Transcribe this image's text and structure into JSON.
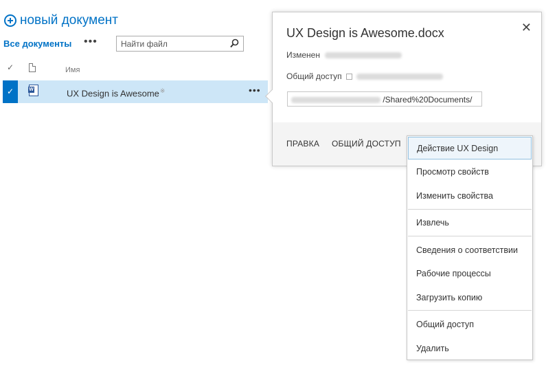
{
  "header": {
    "new_document_label": "новый документ",
    "view_tab_label": "Все документы",
    "view_more_label": "•••",
    "search_placeholder": "Найти файл"
  },
  "list": {
    "check_header": "✓",
    "name_header": "Имя",
    "rows": [
      {
        "name": "UX Design is Awesome",
        "new_badge": "※",
        "selected": true,
        "icon": "word-doc-icon"
      }
    ],
    "row_menu_label": "•••"
  },
  "callout": {
    "title": "UX Design is Awesome.docx",
    "modified_label": "Изменен",
    "sharing_label": "Общий доступ",
    "url_suffix": "/Shared%20Documents/",
    "actions": [
      "ПРАВКА",
      "ОБЩИЙ ДОСТУП"
    ],
    "close_label": "✕"
  },
  "context_menu": {
    "items": [
      "Действие UX Design",
      "Просмотр свойств",
      "Изменить свойства",
      "Извлечь",
      "Сведения о соответствии",
      "Рабочие процессы",
      "Загрузить копию",
      "Общий доступ",
      "Удалить"
    ],
    "highlighted_index": 0
  },
  "colors": {
    "accent": "#0072c6",
    "selected_row": "#cde6f7",
    "footer_bg": "#f4f4f4"
  }
}
